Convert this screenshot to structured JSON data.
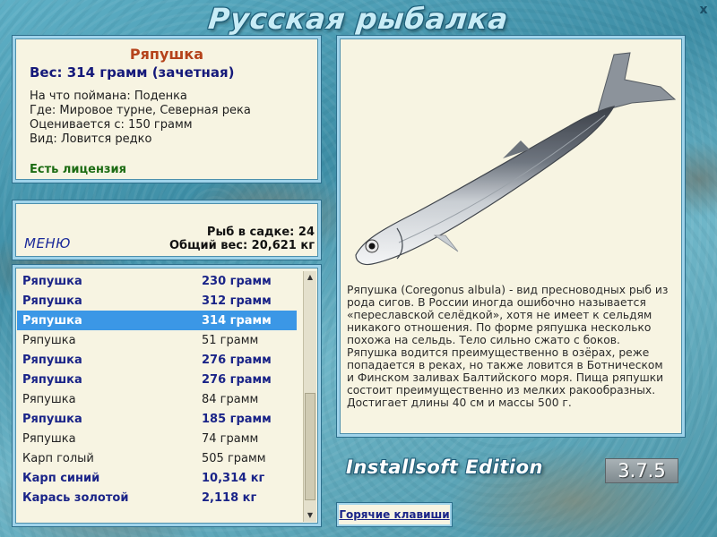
{
  "app": {
    "title": "Русская рыбалка",
    "close_label": "x"
  },
  "catch": {
    "name": "Ряпушка",
    "weight_line": "Вес: 314 грамм (зачетная)",
    "details": [
      "На что поймана: Поденка",
      "Где: Мировое турне, Северная река",
      "Оценивается с: 150 грамм",
      "Вид: Ловится редко"
    ],
    "license": "Есть лицензия"
  },
  "cage": {
    "menu_label": "МЕНЮ",
    "fish_count": "Рыб в садке: 24",
    "total_weight": "Общий вес: 20,621 кг"
  },
  "list": {
    "rows": [
      {
        "name": "Ряпушка",
        "weight": "230 грамм",
        "style": "bold"
      },
      {
        "name": "Ряпушка",
        "weight": "312 грамм",
        "style": "bold"
      },
      {
        "name": "Ряпушка",
        "weight": "314 грамм",
        "style": "sel"
      },
      {
        "name": "Ряпушка",
        "weight": "51 грамм",
        "style": "norm"
      },
      {
        "name": "Ряпушка",
        "weight": "276 грамм",
        "style": "bold"
      },
      {
        "name": "Ряпушка",
        "weight": "276 грамм",
        "style": "bold"
      },
      {
        "name": "Ряпушка",
        "weight": "84 грамм",
        "style": "norm"
      },
      {
        "name": "Ряпушка",
        "weight": "185 грамм",
        "style": "bold"
      },
      {
        "name": "Ряпушка",
        "weight": "74 грамм",
        "style": "norm"
      },
      {
        "name": "Карп голый",
        "weight": "505 грамм",
        "style": "norm"
      },
      {
        "name": "Карп синий",
        "weight": "10,314 кг",
        "style": "bold"
      },
      {
        "name": "Карась золотой",
        "weight": "2,118 кг",
        "style": "bold"
      }
    ]
  },
  "description": {
    "picture_icon": "fish-illustration",
    "text": "Ряпушка (Coregonus albula) - вид пресноводных рыб из рода сигов. В России иногда ошибочно называется «переславской селёдкой», хотя не имеет к сельдям никакого отношения. По форме ряпушка несколько похожа на сельдь. Тело сильно сжато с боков. Ряпушка водится преимущественно в озёрах, реже попадается в реках, но также ловится в Ботническом и Финском заливах Балтийского моря. Пища ряпушки состоит преимущественно из мелких ракообразных. Достигает длины 40 см и массы 500 г."
  },
  "footer": {
    "edition": "Installsoft Edition",
    "version": "3.7.5",
    "hotkeys_label": "Горячие клавиши"
  },
  "colors": {
    "panel_bg": "#f7f4e2",
    "panel_border": "#9fd3ea",
    "selected_row": "#3b97e6",
    "fish_name": "#b5431b",
    "bold_text": "#1a2488",
    "license": "#1b6b12"
  }
}
